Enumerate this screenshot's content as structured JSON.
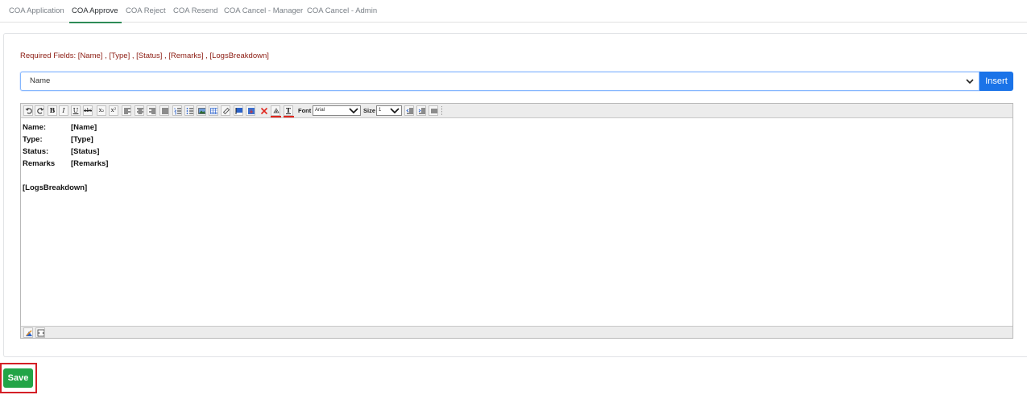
{
  "tabs": [
    {
      "label": "COA Application",
      "active": false
    },
    {
      "label": "COA Approve",
      "active": true
    },
    {
      "label": "COA Reject",
      "active": false
    },
    {
      "label": "COA Resend",
      "active": false
    },
    {
      "label": "COA Cancel - Manager",
      "active": false
    },
    {
      "label": "COA Cancel - Admin",
      "active": false
    }
  ],
  "form": {
    "required_text": "Required Fields: [Name] , [Type] , [Status] , [Remarks] , [LogsBreakdown]",
    "field_select": {
      "selected": "Name"
    },
    "insert_label": "Insert"
  },
  "toolbar": {
    "font_label": "Font",
    "font_value": "Arial",
    "size_label": "Size",
    "size_value": "1",
    "bold": "B",
    "italic": "I",
    "underline": "U",
    "strike": "abc",
    "subscript": "x₂",
    "superscript": "x²",
    "text_color_glyph": "T"
  },
  "editor": {
    "lines": [
      {
        "key": "Name:",
        "value": "[Name]"
      },
      {
        "key": "Type:",
        "value": "[Type]"
      },
      {
        "key": "Status:",
        "value": "[Status]"
      },
      {
        "key": "Remarks",
        "value": "[Remarks]"
      }
    ],
    "logs": "[LogsBreakdown]"
  },
  "actions": {
    "save_label": "Save"
  },
  "colors": {
    "accent_tab": "#2e8b57",
    "insert": "#1a73e8",
    "save": "#22a447",
    "required": "#8b1a10",
    "highlight": "#d41f26"
  }
}
